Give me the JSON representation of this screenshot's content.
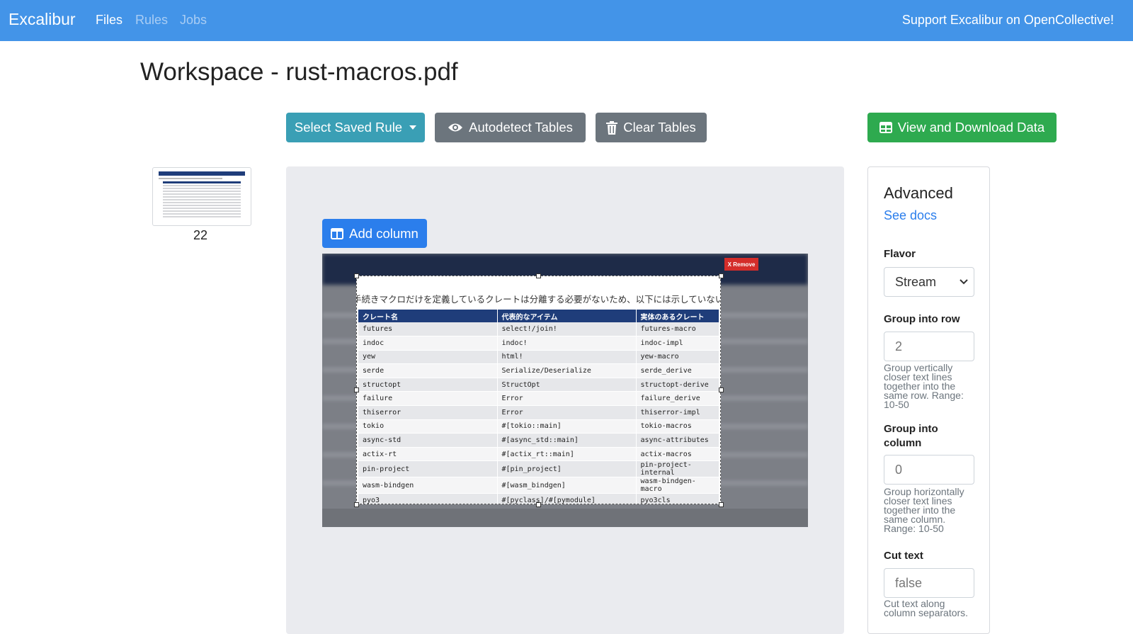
{
  "navbar": {
    "brand": "Excalibur",
    "links": [
      "Files",
      "Rules",
      "Jobs"
    ],
    "support": "Support Excalibur on OpenCollective!"
  },
  "page_title": "Workspace - rust-macros.pdf",
  "toolbar": {
    "select_rule": "Select Saved Rule",
    "autodetect": "Autodetect Tables",
    "clear": "Clear Tables",
    "view_download": "View and Download Data"
  },
  "thumbnail": {
    "page_number": "22"
  },
  "workspace": {
    "add_column": "Add column",
    "remove": "X Remove",
    "caption": "手続きマクロだけを定義しているクレートは分離する必要がないため、以下には示していない",
    "table": {
      "headers": [
        "クレート名",
        "代表的なアイテム",
        "実体のあるクレート"
      ],
      "rows": [
        [
          "futures",
          "select!/join!",
          "futures-macro"
        ],
        [
          "indoc",
          "indoc!",
          "indoc-impl"
        ],
        [
          "yew",
          "html!",
          "yew-macro"
        ],
        [
          "serde",
          "Serialize/Deserialize",
          "serde_derive"
        ],
        [
          "structopt",
          "StructOpt",
          "structopt-derive"
        ],
        [
          "failure",
          "Error",
          "failure_derive"
        ],
        [
          "thiserror",
          "Error",
          "thiserror-impl"
        ],
        [
          "tokio",
          "#[tokio::main]",
          "tokio-macros"
        ],
        [
          "async-std",
          "#[async_std::main]",
          "async-attributes"
        ],
        [
          "actix-rt",
          "#[actix_rt::main]",
          "actix-macros"
        ],
        [
          "pin-project",
          "#[pin_project]",
          "pin-project-internal"
        ],
        [
          "wasm-bindgen",
          "#[wasm_bindgen]",
          "wasm-bindgen-macro"
        ],
        [
          "pyo3",
          "#[pyclass]/#[pymodule]",
          "pyo3cls"
        ]
      ]
    }
  },
  "advanced": {
    "title": "Advanced",
    "docs": "See docs",
    "flavor": {
      "label": "Flavor",
      "value": "Stream"
    },
    "row_tol": {
      "label": "Group into row",
      "value": "2",
      "help": "Group vertically closer text lines together into the same row. Range: 10-50"
    },
    "column_tol": {
      "label": "Group into column",
      "value": "0",
      "help": "Group horizontally closer text lines together into the same column. Range: 10-50"
    },
    "cut_text": {
      "label": "Cut text",
      "value": "false",
      "help": "Cut text along column separators."
    }
  }
}
